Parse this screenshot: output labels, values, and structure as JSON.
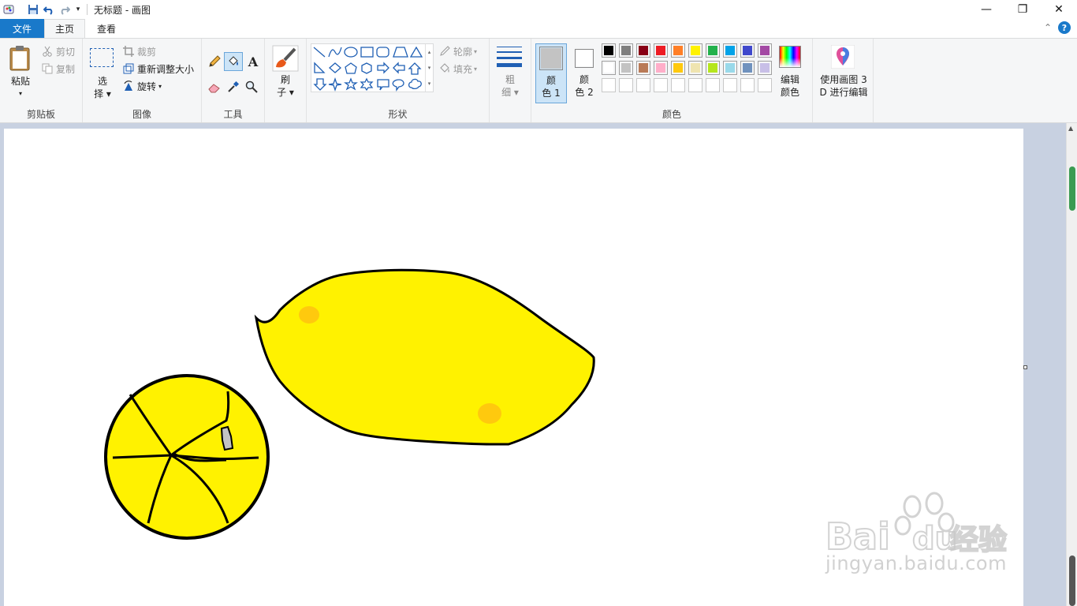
{
  "window": {
    "title": "无标题 - 画图",
    "controls": {
      "minimize": "—",
      "maximize": "❐",
      "close": "✕"
    }
  },
  "tabs": {
    "file": "文件",
    "home": "主页",
    "view": "查看"
  },
  "help": {
    "collapse": "⌃",
    "help": "?"
  },
  "ribbon": {
    "clipboard": {
      "label": "剪贴板",
      "paste": "粘贴",
      "cut": "剪切",
      "copy": "复制"
    },
    "image": {
      "label": "图像",
      "select_line1": "选",
      "select_line2": "择",
      "crop": "裁剪",
      "resize": "重新调整大小",
      "rotate": "旋转"
    },
    "tools": {
      "label": "工具"
    },
    "brushes": {
      "line1": "刷",
      "line2": "子"
    },
    "shapes": {
      "label": "形状",
      "outline": "轮廓",
      "fill": "填充"
    },
    "size": {
      "line1": "粗",
      "line2": "细"
    },
    "colors": {
      "label": "颜色",
      "color1_line1": "颜",
      "color1_line2": "色 1",
      "color2_line1": "颜",
      "color2_line2": "色 2",
      "edit_line1": "编辑",
      "edit_line2": "颜色",
      "color1_value": "#c3c3c3",
      "color2_value": "#ffffff",
      "palette_row1": [
        "#000000",
        "#7f7f7f",
        "#880015",
        "#ed1c24",
        "#ff7f27",
        "#fff200",
        "#22b14c",
        "#00a2e8",
        "#3f48cc",
        "#a349a4"
      ],
      "palette_row2": [
        "#ffffff",
        "#c3c3c3",
        "#b97a57",
        "#ffaec9",
        "#ffc90e",
        "#efe4b0",
        "#b5e61d",
        "#99d9ea",
        "#7092be",
        "#c8bfe7"
      ],
      "palette_row3": [
        "#ffffff",
        "#ffffff",
        "#ffffff",
        "#ffffff",
        "#ffffff",
        "#ffffff",
        "#ffffff",
        "#ffffff",
        "#ffffff",
        "#ffffff"
      ]
    },
    "paint3d": {
      "line1": "使用画图 3",
      "line2": "D 进行编辑"
    }
  },
  "canvas": {
    "lemon_fill": "#fff200",
    "dot_fill": "#ffc90e",
    "outline": "#000000"
  },
  "watermark": {
    "brand": "Bai",
    "brand2": "du",
    "cn": "经验",
    "url": "jingyan.baidu.com"
  }
}
